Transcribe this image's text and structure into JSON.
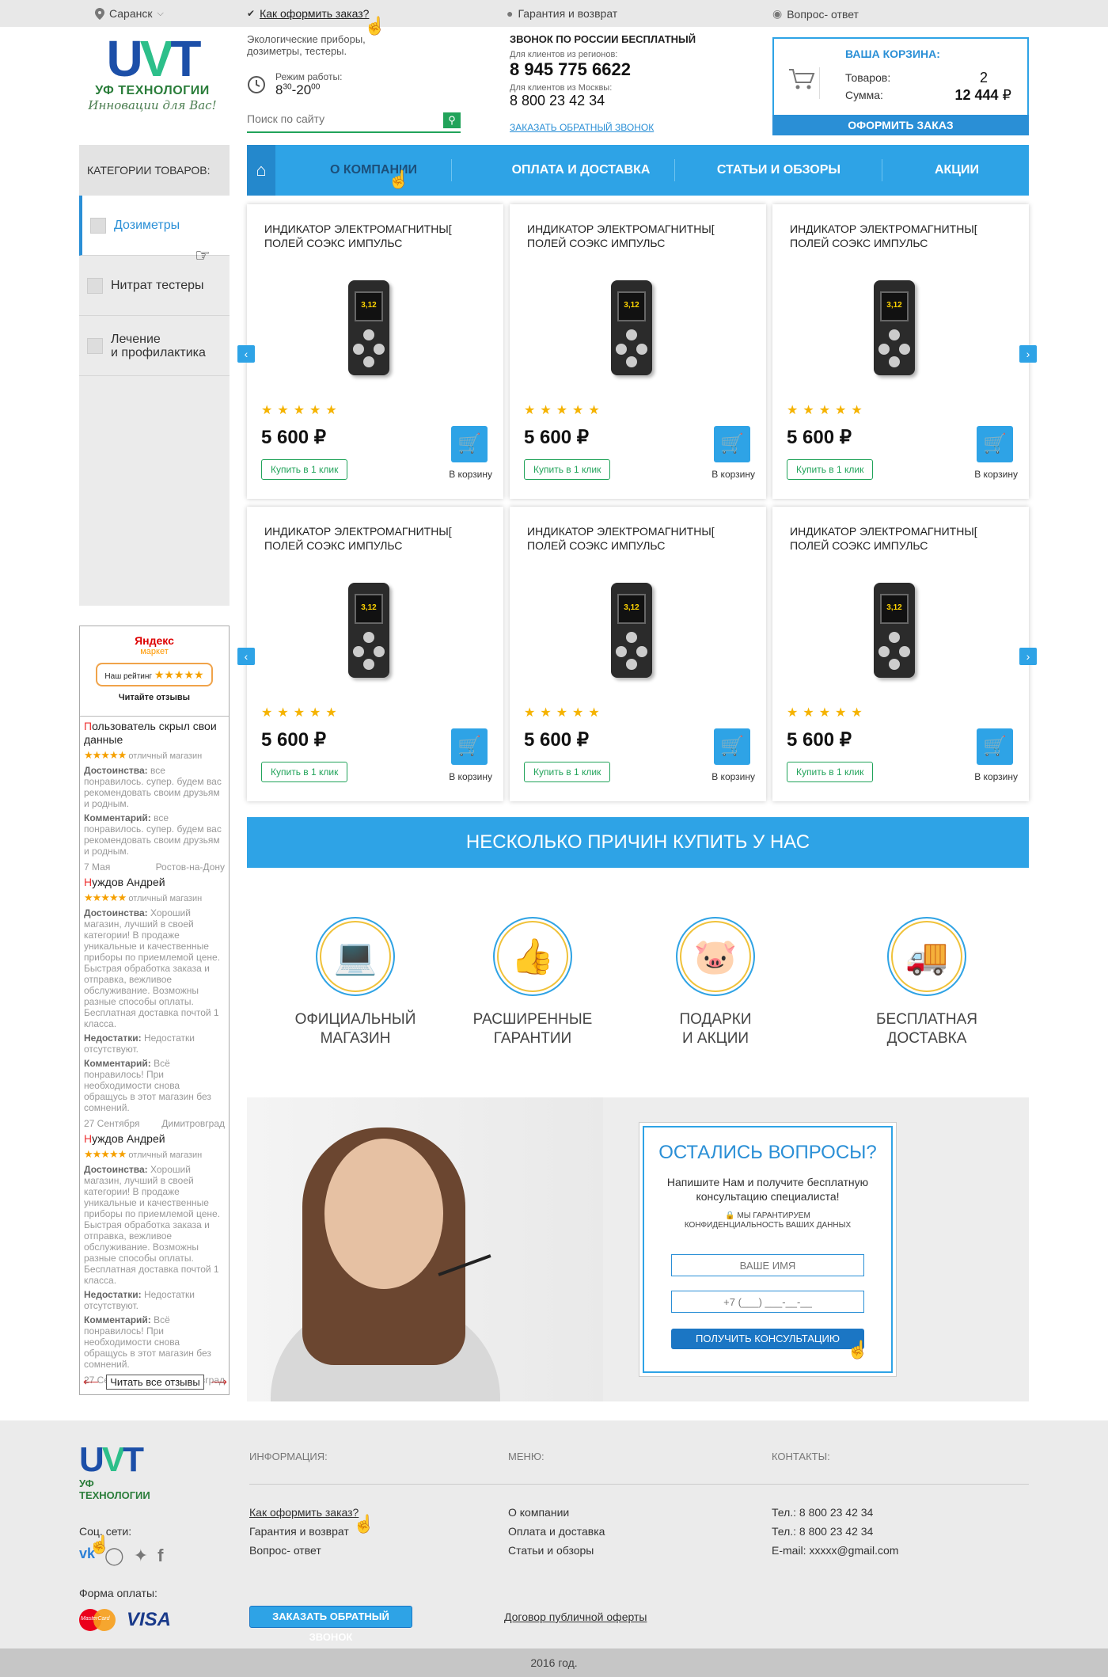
{
  "topbar": {
    "city": "Саранск",
    "how_to_order": "Как оформить заказ?",
    "warranty": "Гарантия и возврат",
    "faq": "Вопрос- ответ"
  },
  "logo": {
    "mark_u": "U",
    "mark_v": "V",
    "mark_t": "T",
    "name": "УФ ТЕХНОЛОГИИ",
    "slogan": "Инновации для Вас!"
  },
  "header": {
    "eco": "Экологические приборы, дозиметры, тестеры.",
    "work_label": "Режим работы:",
    "work_from": "8",
    "work_from_min": "30",
    "work_to": "-20",
    "work_to_min": "00",
    "search_placeholder": "Поиск по сайту",
    "call_header": "ЗВОНОК ПО РОССИИ БЕСПЛАТНЫЙ",
    "regions_label": "Для клиентов из регионов:",
    "regions_phone": "8 945 775 6622",
    "moscow_label": "Для клиентов из Москвы:",
    "moscow_phone": "8 800 23 42 34",
    "callback": "ЗАКАЗАТЬ ОБРАТНЫЙ ЗВОНОК"
  },
  "cart": {
    "title": "ВАША КОРЗИНА:",
    "items_label": "Товаров:",
    "items_value": "2",
    "sum_label": "Сумма:",
    "sum_value": "12 444",
    "currency": "₽",
    "checkout": "ОФОРМИТЬ ЗАКАЗ"
  },
  "sidebar": {
    "header": "КАТЕГОРИИ ТОВАРОВ:",
    "items": [
      {
        "label": "Дозиметры"
      },
      {
        "label": "Нитрат тестеры"
      },
      {
        "label": "Лечение\nи профилактика"
      }
    ]
  },
  "nav": {
    "items": [
      {
        "label": "О КОМПАНИИ"
      },
      {
        "label": "ОПЛАТА И ДОСТАВКА"
      },
      {
        "label": "СТАТЬИ И ОБЗОРЫ"
      },
      {
        "label": "АКЦИИ"
      }
    ]
  },
  "products": [
    {
      "name": "ИНДИКАТОР ЭЛЕКТРОМАГНИТНЫ[\nПОЛЕЙ СОЭКС ИМПУЛЬС",
      "price": "5 600  ₽",
      "rating": 5,
      "one_click": "Купить в 1 клик",
      "to_cart": "В корзину",
      "screen": "3,12"
    },
    {
      "name": "ИНДИКАТОР ЭЛЕКТРОМАГНИТНЫ[\nПОЛЕЙ СОЭКС ИМПУЛЬС",
      "price": "5 600  ₽",
      "rating": 5,
      "one_click": "Купить в 1 клик",
      "to_cart": "В корзину",
      "screen": "3,12"
    },
    {
      "name": "ИНДИКАТОР ЭЛЕКТРОМАГНИТНЫ[\nПОЛЕЙ СОЭКС ИМПУЛЬС",
      "price": "5 600  ₽",
      "rating": 5,
      "one_click": "Купить в 1 клик",
      "to_cart": "В корзину",
      "screen": "3,12"
    },
    {
      "name": "ИНДИКАТОР ЭЛЕКТРОМАГНИТНЫ[\nПОЛЕЙ СОЭКС ИМПУЛЬС",
      "price": "5 600  ₽",
      "rating": 5,
      "one_click": "Купить в 1 клик",
      "to_cart": "В корзину",
      "screen": "3,12"
    },
    {
      "name": "ИНДИКАТОР ЭЛЕКТРОМАГНИТНЫ[\nПОЛЕЙ СОЭКС ИМПУЛЬС",
      "price": "5 600  ₽",
      "rating": 5,
      "one_click": "Купить в 1 клик",
      "to_cart": "В корзину",
      "screen": "3,12"
    },
    {
      "name": "ИНДИКАТОР ЭЛЕКТРОМАГНИТНЫ[\nПОЛЕЙ СОЭКС ИМПУЛЬС",
      "price": "5 600  ₽",
      "rating": 5,
      "one_click": "Купить в 1 клик",
      "to_cart": "В корзину",
      "screen": "3,12"
    }
  ],
  "reasons": {
    "title": "НЕСКОЛЬКО ПРИЧИН КУПИТЬ У НАС",
    "items": [
      {
        "label": "ОФИЦИАЛЬНЫЙ\nМАГАЗИН",
        "icon": "laptop-icon"
      },
      {
        "label": "РАСШИРЕННЫЕ\nГАРАНТИИ",
        "icon": "thumbs-up-icon"
      },
      {
        "label": "ПОДАРКИ\nИ АКЦИИ",
        "icon": "piggy-bank-icon"
      },
      {
        "label": "БЕСПЛАТНАЯ\nДОСТАВКА",
        "icon": "truck-icon"
      }
    ]
  },
  "consult": {
    "title": "ОСТАЛИСЬ ВОПРОСЫ?",
    "subtitle": "Напишите Нам и получите бесплатную\nконсультацию специалиста!",
    "guarantee": "МЫ ГАРАНТИРУЕМ\nКОНФИДЕНЦИАЛЬНОСТЬ ВАШИХ ДАННЫХ",
    "name_placeholder": "ВАШЕ ИМЯ",
    "phone_placeholder": "+7 (___) ___-__-__",
    "submit": "ПОЛУЧИТЬ КОНСУЛЬТАЦИЮ"
  },
  "reviews": {
    "market_brand": "Яндекс",
    "market_word": "маркет",
    "rating_label": "Наш рейтинг",
    "rating_stars": "★★★★★",
    "read_reviews": "Читайте отзывы",
    "items": [
      {
        "first": "П",
        "rest": "ользователь скрыл свои данные",
        "stars": "★★★★★",
        "grade": "отличный магазин",
        "pros_label": "Достоинства:",
        "pros": "все понравилось. супер. будем вас рекомендовать своим друзьям и родным.",
        "cons_label": "",
        "cons": "",
        "comment_label": "Комментарий:",
        "comment": "все понравилось. супер. будем вас рекомендовать своим друзьям и родным.",
        "date": "7 Мая",
        "city": "Ростов-на-Дону"
      },
      {
        "first": "Н",
        "rest": "уждов Андрей",
        "stars": "★★★★★",
        "grade": "отличный магазин",
        "pros_label": "Достоинства:",
        "pros": "Хороший магазин, лучший в своей категории! В продаже уникальные и качественные приборы по приемлемой цене. Быстрая обработка заказа и отправка, вежливое обслуживание. Возможны разные способы оплаты. Бесплатная доставка почтой 1 класса.",
        "cons_label": "Недостатки:",
        "cons": "Недостатки отсутствуют.",
        "comment_label": "Комментарий:",
        "comment": "Всё понравилось! При необходимости снова обращусь в этот магазин без сомнений.",
        "date": "27 Сентября",
        "city": "Димитровград"
      },
      {
        "first": "Н",
        "rest": "уждов Андрей",
        "stars": "★★★★★",
        "grade": "отличный магазин",
        "pros_label": "Достоинства:",
        "pros": "Хороший магазин, лучший в своей категории! В продаже уникальные и качественные приборы по приемлемой цене. Быстрая обработка заказа и отправка, вежливое обслуживание. Возможны разные способы оплаты. Бесплатная доставка почтой 1 класса.",
        "cons_label": "Недостатки:",
        "cons": "Недостатки отсутствуют.",
        "comment_label": "Комментарий:",
        "comment": "Всё понравилось! При необходимости снова обращусь в этот магазин без сомнений.",
        "date": "27 Сентября",
        "city": "Димитровград"
      }
    ],
    "read_all": "Читать все отзывы"
  },
  "footer": {
    "logo_name": "УФ ТЕХНОЛОГИИ",
    "social_label": "Соц. сети:",
    "payment_label": "Форма оплаты:",
    "mastercard": "MasterCard",
    "visa": "VISA",
    "info_header": "ИНФОРМАЦИЯ:",
    "menu_header": "МЕНЮ:",
    "contacts_header": "КОНТАКТЫ:",
    "info_links": [
      "Как оформить заказ?",
      "Гарантия и возврат",
      "Вопрос- ответ"
    ],
    "menu_links": [
      "О компании",
      "Оплата и доставка",
      "Статьи и обзоры"
    ],
    "contacts": [
      "Тел.: 8 800 23 42 34",
      "Тел.: 8 800 23 42 34",
      "E-mail: xxxxx@gmail.com"
    ],
    "callback": "ЗАКАЗАТЬ ОБРАТНЫЙ ЗВОНОК",
    "offer": "Договор публичной оферты",
    "copyright": "2016 год."
  },
  "colors": {
    "accent": "#2ea3e6",
    "accent_dark": "#1b76c4",
    "green": "#21a35a",
    "star": "#f5b300"
  }
}
